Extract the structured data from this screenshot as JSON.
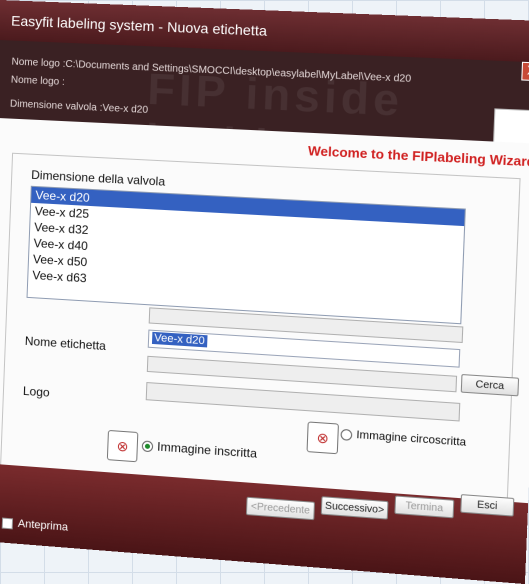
{
  "window": {
    "title": "Easyfit labeling system - Nuova etichetta",
    "close_glyph": "X"
  },
  "header": {
    "logo_path": "Nome logo :C:\\Documents and Settings\\SMOCCI\\desktop\\easylabel\\MyLabel\\Vee-x d20",
    "logo_name": "Nome logo :",
    "valve_size": "Dimensione valvola :Vee-x d20",
    "watermark": "FIP inside inside"
  },
  "welcome": "Welcome to the FIPlabeling Wizard",
  "size_group": {
    "label": "Dimensione della valvola",
    "items": [
      "Vee-x d20",
      "Vee-x d25",
      "Vee-x d32",
      "Vee-x d40",
      "Vee-x d50",
      "Vee-x d63"
    ],
    "selected": "Vee-x d20"
  },
  "label_name": {
    "label": "Nome etichetta",
    "value": "Vee-x d20",
    "search_button": "Cerca"
  },
  "logo": {
    "label": "Logo"
  },
  "radios": {
    "inscribed": "Immagine inscritta",
    "circumscribed": "Immagine circoscritta",
    "selected": "inscribed"
  },
  "footer_buttons": {
    "previous": "<Precedente",
    "next": "Successivo>",
    "finish": "Termina",
    "exit": "Esci"
  },
  "preview_checkbox": "Anteprima",
  "colors": {
    "brand_dark": "#4b1a1d",
    "accent_red": "#d02020",
    "selection": "#3461c1"
  },
  "icons": {
    "valve_inscribed": "valve-inscribed-icon",
    "valve_circumscribed": "valve-circumscribed-icon"
  }
}
